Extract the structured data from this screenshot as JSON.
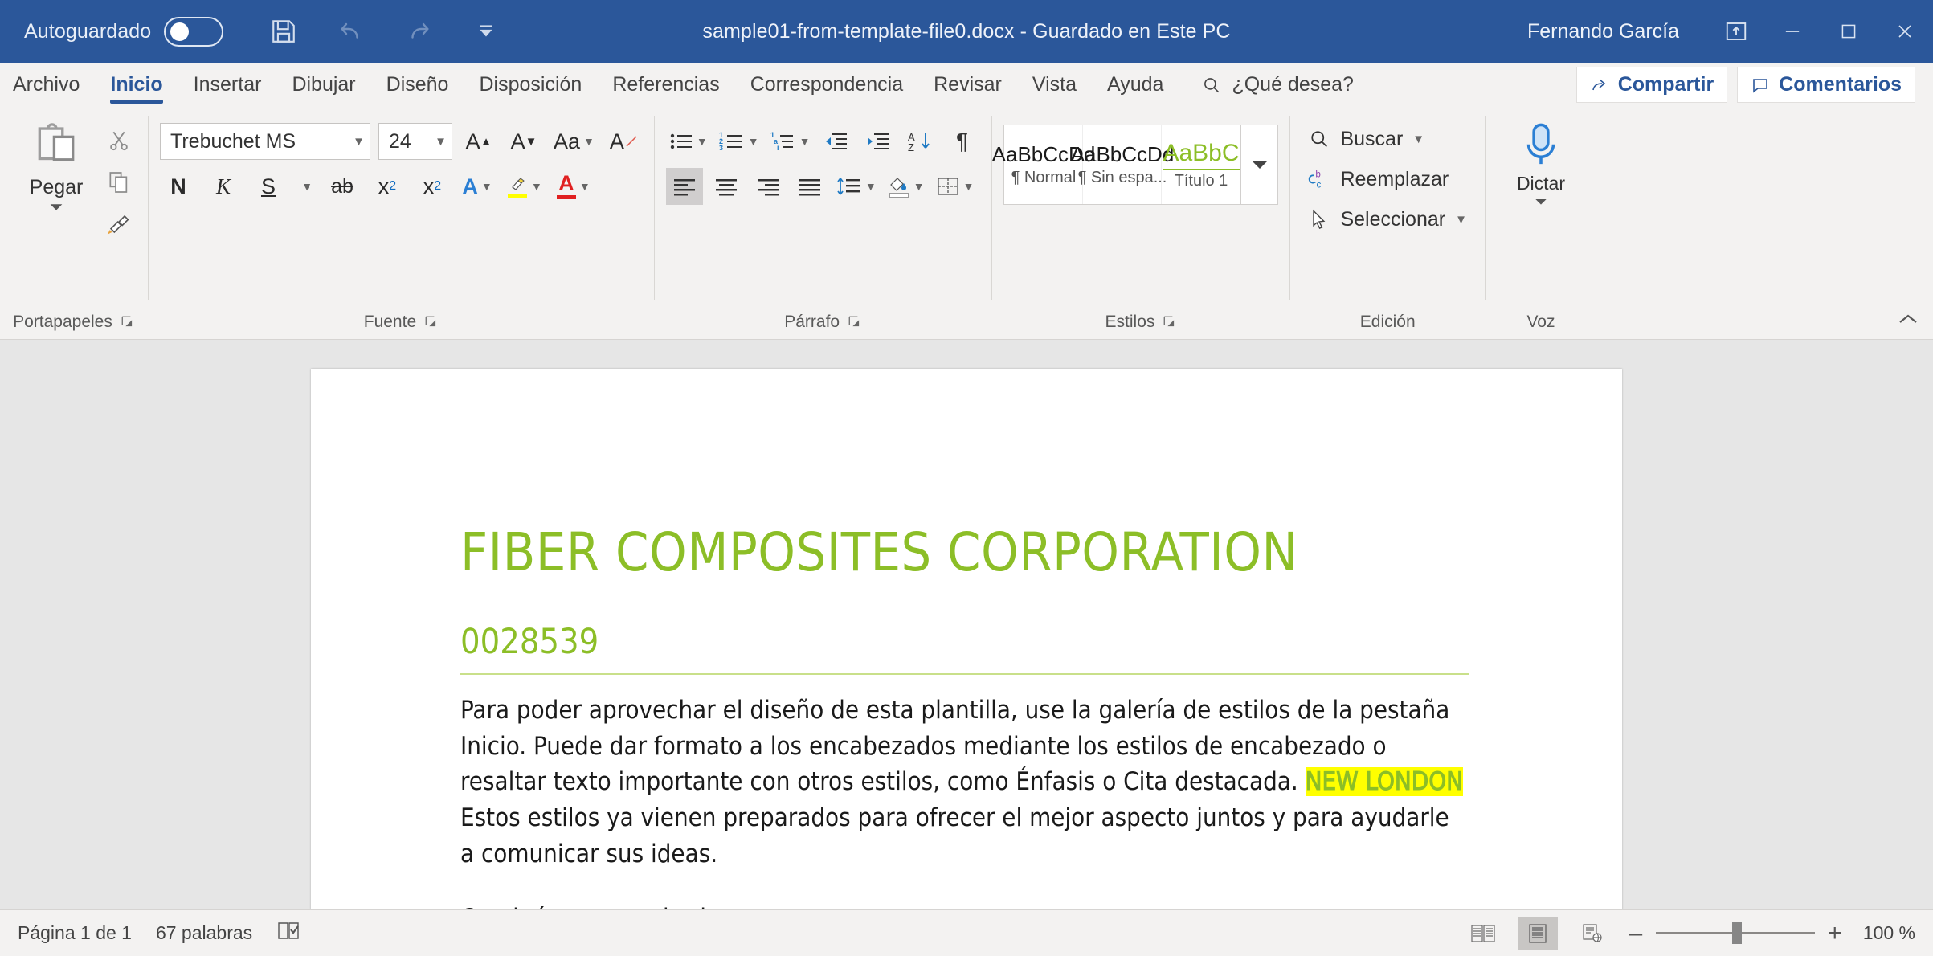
{
  "titlebar": {
    "autosave_label": "Autoguardado",
    "autosave_state": "off",
    "save_icon": "save-icon",
    "undo_icon": "undo-icon",
    "redo_icon": "redo-icon",
    "customize_icon": "customize-quick-access-icon",
    "document_title": "sample01-from-template-file0.docx  -  Guardado en Este PC",
    "username": "Fernando García",
    "ribbon_display_icon": "ribbon-display-options-icon",
    "minimize_icon": "minimize-icon",
    "maximize_icon": "maximize-icon",
    "close_icon": "close-icon",
    "bg_color": "#2b579a"
  },
  "tabs": [
    {
      "label": "Archivo",
      "active": false
    },
    {
      "label": "Inicio",
      "active": true
    },
    {
      "label": "Insertar",
      "active": false
    },
    {
      "label": "Dibujar",
      "active": false
    },
    {
      "label": "Diseño",
      "active": false
    },
    {
      "label": "Disposición",
      "active": false
    },
    {
      "label": "Referencias",
      "active": false
    },
    {
      "label": "Correspondencia",
      "active": false
    },
    {
      "label": "Revisar",
      "active": false
    },
    {
      "label": "Vista",
      "active": false
    },
    {
      "label": "Ayuda",
      "active": false
    }
  ],
  "tellme": {
    "label": "¿Qué desea?",
    "icon": "search-icon"
  },
  "header_buttons": [
    {
      "label": "Compartir",
      "icon": "share-icon"
    },
    {
      "label": "Comentarios",
      "icon": "comments-icon"
    }
  ],
  "ribbon": {
    "groups": [
      {
        "name": "Portapapeles",
        "label": "Portapapeles",
        "has_launcher": true
      },
      {
        "name": "Fuente",
        "label": "Fuente",
        "has_launcher": true
      },
      {
        "name": "Párrafo",
        "label": "Párrafo",
        "has_launcher": true
      },
      {
        "name": "Estilos",
        "label": "Estilos",
        "has_launcher": true
      },
      {
        "name": "Edición",
        "label": "Edición",
        "has_launcher": false
      },
      {
        "name": "Voz",
        "label": "Voz",
        "has_launcher": false
      }
    ],
    "clipboard": {
      "paste_label": "Pegar",
      "paste_icon": "paste-icon",
      "cut_icon": "scissors-icon",
      "copy_icon": "copy-icon",
      "format_painter_icon": "format-painter-icon"
    },
    "font": {
      "font_name": "Trebuchet MS",
      "font_size": "24",
      "grow_font_label": "A",
      "shrink_font_label": "A",
      "change_case_label": "Aa",
      "clear_formatting_label": "A",
      "bold_label": "N",
      "italic_label": "K",
      "underline_label": "S",
      "strikethrough_label": "ab",
      "subscript_label": "x",
      "subscript_sub": "2",
      "superscript_label": "x",
      "superscript_sup": "2",
      "text_effects_label": "A",
      "highlight_label": "A",
      "font_color_label": "A",
      "highlight_color": "#ffff00",
      "font_color": "#e02020",
      "text_effects_color": "#0d6abf"
    },
    "paragraph": {
      "bullets_icon": "bullet-list-icon",
      "numbering_icon": "numbered-list-icon",
      "multilevel_icon": "multilevel-list-icon",
      "decrease_indent_icon": "decrease-indent-icon",
      "increase_indent_icon": "increase-indent-icon",
      "sort_icon": "sort-icon",
      "marks_icon": "paragraph-marks-icon",
      "align_left_icon": "align-left-icon",
      "align_center_icon": "align-center-icon",
      "align_right_icon": "align-right-icon",
      "justify_icon": "justify-icon",
      "line_spacing_icon": "line-spacing-icon",
      "shading_icon": "shading-icon",
      "borders_icon": "borders-icon",
      "active_alignment": "align-left"
    },
    "styles": [
      {
        "preview": "AaBbCcDd",
        "name": "¶ Normal",
        "green": false
      },
      {
        "preview": "AaBbCcDd",
        "name": "¶ Sin espa...",
        "green": false
      },
      {
        "preview": "AaBbC",
        "name": "Título 1",
        "green": true
      }
    ],
    "styles_more_icon": "more-styles-icon",
    "editing": {
      "find_label": "Buscar",
      "find_icon": "search-icon",
      "replace_label": "Reemplazar",
      "replace_icon": "replace-icon",
      "select_label": "Seleccionar",
      "select_icon": "select-arrow-icon"
    },
    "voice": {
      "dictate_label": "Dictar",
      "dictate_icon": "microphone-icon"
    },
    "collapse_icon": "collapse-ribbon-icon"
  },
  "document": {
    "title": "FIBER COMPOSITES CORPORATION",
    "subtitle": "0028539",
    "paragraph_1_part1": "Para poder aprovechar el diseño de esta plantilla, use la galería de estilos de la pestaña Inicio. Puede dar formato a los encabezados mediante los estilos de encabezado o resaltar texto importante con otros estilos, como Énfasis o Cita destacada. ",
    "paragraph_1_highlight": "NEW LONDON",
    "paragraph_1_part2": " Estos estilos ya vienen preparados para ofrecer el mejor aspecto juntos y para ayudarle a comunicar sus ideas.",
    "paragraph_2": "Continúe para probarlo.",
    "accent_color": "#8cbe27",
    "highlight_color": "#ffff00"
  },
  "statusbar": {
    "page_label": "Página 1 de 1",
    "word_count": "67 palabras",
    "proofing_icon": "proofing-icon",
    "read_mode_icon": "read-mode-icon",
    "print_layout_icon": "print-layout-icon",
    "web_layout_icon": "web-layout-icon",
    "zoom_out_label": "–",
    "zoom_in_label": "+",
    "zoom_value": "100 %",
    "active_view": "print-layout"
  }
}
